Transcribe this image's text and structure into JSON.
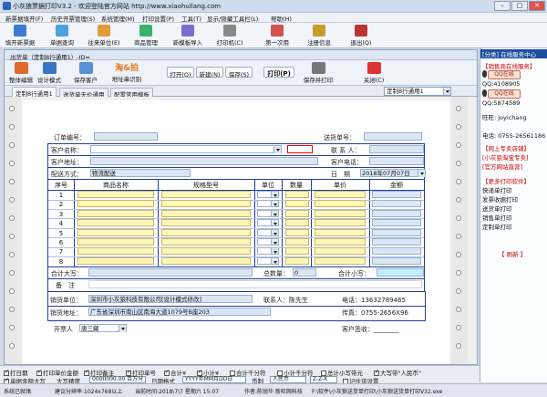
{
  "window": {
    "title": "小灰狼票据打印V3.2 - 欢迎登陆官方网站 http://www.xiaohuilang.com"
  },
  "menu": [
    "新票据填开(F)",
    "历史开票管理(S)",
    "系统管理(M)",
    "打印设置(P)",
    "工具(T)",
    "显示/隐藏工具栏(L)",
    "帮助(H)"
  ],
  "toolbar": [
    "填开新票据",
    "单据查询",
    "往来单位(E)",
    "商品管理",
    "新模板导入",
    "打印机(C)",
    "第一次用",
    "注册信息",
    "退出(Q)"
  ],
  "inner_window": {
    "title": "出货单（定制8行通用1）-ID="
  },
  "inner_toolbar": {
    "items": [
      "整体编辑",
      "设计模式",
      "保存客户",
      "地址串识别",
      "打开(O)",
      "新建(N)",
      "保存(S)",
      "打印(P)",
      "保存并打印",
      "关闭(C)"
    ],
    "logo": "淘&拍"
  },
  "tabs": [
    "定制8行通用1",
    "送货单无价通用",
    "配置常用模板"
  ],
  "template_select": "定制8行通用1",
  "form": {
    "order_no_label": "订单编号：",
    "delivery_no_label": "送货单号：",
    "customer_name_label": "客户名称：",
    "contact_label": "联 系 人：",
    "customer_addr_label": "客户地址：",
    "customer_phone_label": "客户电话：",
    "delivery_method_label": "配送方式：",
    "delivery_method_value": "物流配送",
    "date_label": "日　期",
    "date_value": "2018年07月07日",
    "headers": [
      "序号",
      "商品名称",
      "规格型号",
      "单位",
      "数量",
      "单价",
      "金额"
    ],
    "rows": [
      "1",
      "2",
      "3",
      "4",
      "5",
      "6",
      "7",
      "8"
    ],
    "total_upper_label": "合计大写：",
    "total_qty_label": "总数量：",
    "total_qty_value": "0",
    "total_small_label": "合计小写：",
    "remark_label": "备　注",
    "seller_label": "销货单位：",
    "seller_value": "深圳市小灰狼科技有限公司[设计模式修改]",
    "seller_contact": "联系人：陈先生",
    "seller_phone": "电话：13632789465",
    "seller_addr_label": "销货地址：",
    "seller_addr_value": "广东省深圳市南山区南海大道1079号B座203",
    "fax": "传真：0755-2656X96",
    "issuer_label": "开票人",
    "issuer_value": "唐三藏",
    "signature": "客户签收：________"
  },
  "options": {
    "checks": [
      {
        "label": "打日期",
        "on": true
      },
      {
        "label": "打印单价金额",
        "on": true
      },
      {
        "label": "打印备注",
        "on": true
      },
      {
        "label": "打印单号",
        "on": true
      },
      {
        "label": "合计¥",
        "on": true
      },
      {
        "label": "小计¥",
        "on": true
      },
      {
        "label": "合计千分符",
        "on": false
      },
      {
        "label": "小计千分符",
        "on": false
      },
      {
        "label": "总计小写带元",
        "on": false
      },
      {
        "label": "大写带\"人民币\"",
        "on": true
      }
    ],
    "row2": [
      "单据金额大写",
      "大写精度",
      "0000000.00 百万分",
      "日期格式",
      "YYYY年MM月DD日",
      "币制",
      "人民币",
      "Z-Z-X",
      "记住该设置"
    ]
  },
  "right_panel": {
    "official": "[分类] 在线服务中心",
    "items": [
      "【销售商在线服务】",
      "QQ:4108905",
      "QQ:5874589",
      "旺旺: joyichang",
      "电话: 0755-26561186",
      "【网上专卖店铺】",
      "[小灰狼淘宝专卖]",
      "[官方网站直营]",
      "【更多打印软件】",
      "快递单打印",
      "发票收据打印",
      "送货单打印",
      "销售单打印",
      "定制单打印"
    ],
    "qq_label": "QQ在线",
    "bottom": "【 刷新 】"
  },
  "status": [
    "系统已就绪",
    "建议分辨率:1024x768以上",
    "当前时间:2018\\7\\7 星期六 15:07",
    "作者:陈锐华 新旺网科技",
    "F:\\软件\\小灰狼送货单打印\\小灰狼送货单打印V32.exe"
  ]
}
